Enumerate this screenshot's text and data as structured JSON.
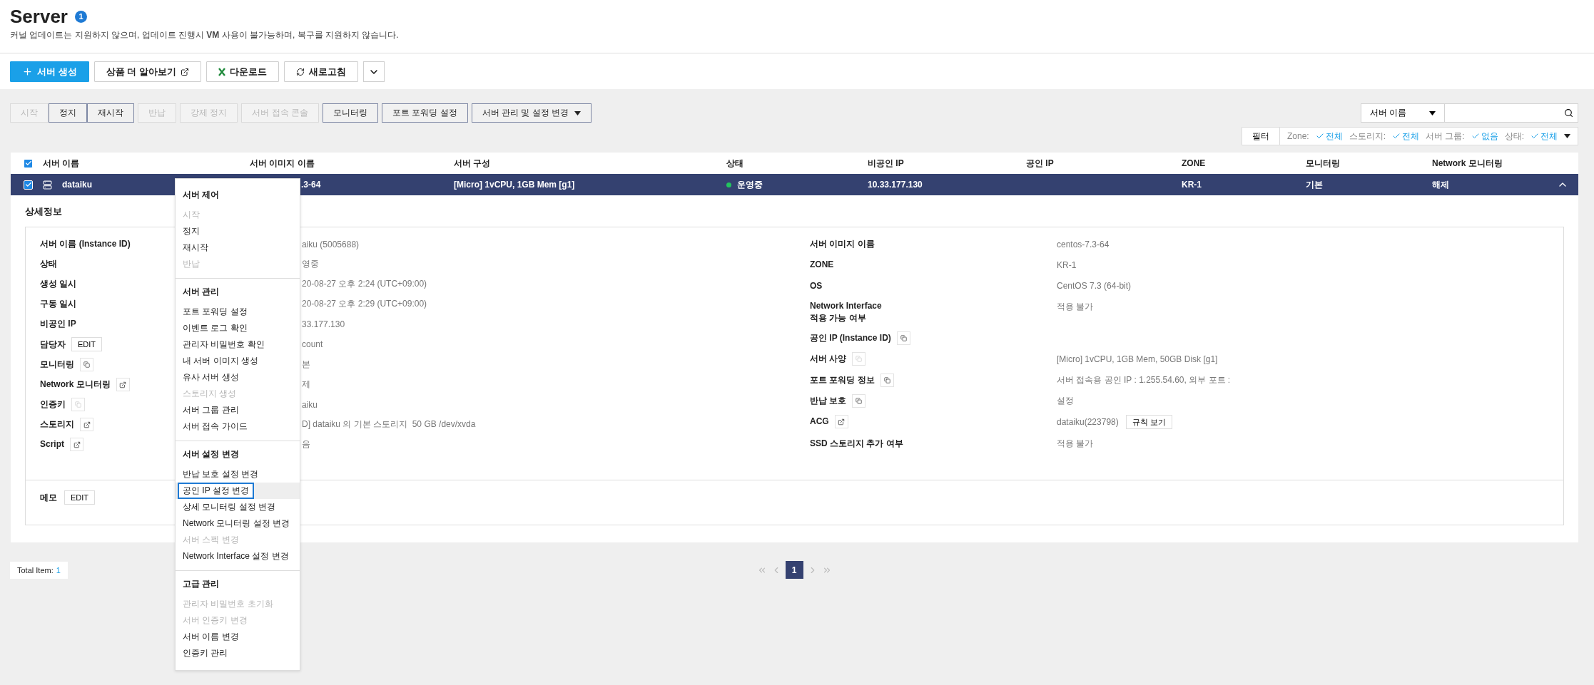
{
  "header": {
    "title": "Server",
    "badge": "1",
    "subtitle": "커널 업데이트는 지원하지 않으며, 업데이트 진행시 **VM** 사용이 불가능하며, 복구를 지원하지 않습니다."
  },
  "top_toolbar": [
    {
      "kind": "primary",
      "label": "서버 생성"
    },
    {
      "kind": "link",
      "label": "상품 더 알아보기"
    },
    {
      "kind": "excel",
      "label": "다운로드"
    },
    {
      "kind": "refresh",
      "label": "새로고침"
    },
    {
      "kind": "more"
    }
  ],
  "action_bar": [
    {
      "kind": "button",
      "label": "시작",
      "disabled": true
    },
    {
      "kind": "joined",
      "label": "정지",
      "disabled": false
    },
    {
      "kind": "joined",
      "label": "재시작",
      "disabled": false
    },
    {
      "kind": "button",
      "label": "반납",
      "disabled": true
    },
    {
      "kind": "button",
      "label": "강제 정지",
      "disabled": true
    },
    {
      "kind": "button",
      "label": "서버 접속 콘솔",
      "disabled": true
    },
    {
      "kind": "button",
      "label": "모니터링",
      "disabled": false
    },
    {
      "kind": "button",
      "label": "포트 포워딩 설정",
      "disabled": false
    },
    {
      "kind": "dropdown",
      "label": "서버 관리 및 설정 변경",
      "disabled": false
    }
  ],
  "search": {
    "field": "서버 이름"
  },
  "filter": {
    "button": "필터",
    "criteria": [
      {
        "name": "Zone:",
        "value": "전체"
      },
      {
        "name": "스토리지:",
        "value": "전체"
      },
      {
        "name": "서버 그룹:",
        "value": "없음"
      },
      {
        "name": "상태:",
        "value": "전체"
      }
    ]
  },
  "table": {
    "all_checked": true,
    "columns": [
      "서버 이름",
      "서버 이미지 이름",
      "서버 구성",
      "상태",
      "비공인 IP",
      "공인 IP",
      "ZONE",
      "모니터링",
      "Network 모니터링"
    ],
    "rows": [
      {
        "checked": true,
        "selected": true,
        "expanded": true,
        "name": "dataiku",
        "image": ".3-64",
        "spec": "[Micro] 1vCPU, 1GB Mem [g1]",
        "status": "운영중",
        "color": "#22c55e",
        "private_ip": "10.33.177.130",
        "zone": "KR-1",
        "monitoring": "기본",
        "network_monitoring": "해제"
      }
    ]
  },
  "detail": {
    "title": "상세정보",
    "left": [
      {
        "label": "서버 이름 (Instance ID)",
        "value": "aiku (5005688)"
      },
      {
        "label": "상태",
        "value": "영중"
      },
      {
        "label": "생성 일시",
        "value": "20-08-27 오후 2:24 (UTC+09:00)"
      },
      {
        "label": "구동 일시",
        "value": "20-08-27 오후 2:29 (UTC+09:00)"
      },
      {
        "label": "비공인 IP",
        "value": "33.177.130"
      },
      {
        "label": "담당자",
        "action": {
          "kind": "edit",
          "label": "EDIT"
        },
        "value": "count"
      },
      {
        "label": "모니터링",
        "action": {
          "kind": "copy",
          "disabled": false
        },
        "value": "본"
      },
      {
        "label": "Network 모니터링",
        "action": {
          "kind": "link",
          "disabled": false
        },
        "value": "제"
      },
      {
        "label": "인증키",
        "action": {
          "kind": "copy",
          "disabled": true
        },
        "value": "aiku"
      },
      {
        "label": "스토리지",
        "action": {
          "kind": "link",
          "disabled": false
        },
        "value": "D] dataiku 의 기본 스토리지  50 GB /dev/xvda"
      },
      {
        "label": "Script",
        "action": {
          "kind": "link",
          "disabled": false
        },
        "value": "음"
      }
    ],
    "right": [
      {
        "label": "서버 이미지 이름",
        "value": "centos-7.3-64"
      },
      {
        "label": "ZONE",
        "value": "KR-1"
      },
      {
        "label": "OS",
        "value": "CentOS 7.3 (64-bit)"
      },
      {
        "label": "Network Interface\n적용 가능 여부",
        "value": "적용 불가"
      },
      {
        "label": "공인 IP (Instance ID)",
        "action": {
          "kind": "copy",
          "disabled": false
        }
      },
      {
        "label": "서버 사양",
        "action": {
          "kind": "copy",
          "disabled": true
        },
        "value": "[Micro] 1vCPU, 1GB Mem, 50GB Disk [g1]"
      },
      {
        "label": "포트 포워딩 정보",
        "action": {
          "kind": "copy",
          "disabled": false
        },
        "value": "서버 접속용 공인 IP : 1.255.54.60, 외부 포트 :"
      },
      {
        "label": "반납 보호",
        "action": {
          "kind": "copy",
          "disabled": false
        },
        "value": "설정"
      },
      {
        "label": "ACG",
        "action": {
          "kind": "link",
          "disabled": false
        },
        "value": "dataiku(223798)",
        "value_button": "규칙 보기"
      },
      {
        "label": "SSD 스토리지 추가 여부",
        "value": "적용 불가"
      }
    ],
    "memo": {
      "label": "메모",
      "action": "EDIT"
    }
  },
  "context_menu": [
    {
      "title": "서버 제어",
      "items": [
        {
          "label": "시작",
          "disabled": true,
          "selected": false
        },
        {
          "label": "정지",
          "disabled": false,
          "selected": false
        },
        {
          "label": "재시작",
          "disabled": false,
          "selected": false
        },
        {
          "label": "반납",
          "disabled": true,
          "selected": false
        }
      ]
    },
    {
      "title": "서버 관리",
      "items": [
        {
          "label": "포트 포워딩 설정",
          "disabled": false,
          "selected": false
        },
        {
          "label": "이벤트 로그 확인",
          "disabled": false,
          "selected": false
        },
        {
          "label": "관리자 비밀번호 확인",
          "disabled": false,
          "selected": false
        },
        {
          "label": "내 서버 이미지 생성",
          "disabled": false,
          "selected": false
        },
        {
          "label": "유사 서버 생성",
          "disabled": false,
          "selected": false
        },
        {
          "label": "스토리지 생성",
          "disabled": true,
          "selected": false
        },
        {
          "label": "서버 그룹 관리",
          "disabled": false,
          "selected": false
        },
        {
          "label": "서버 접속 가이드",
          "disabled": false,
          "selected": false
        }
      ]
    },
    {
      "title": "서버 설정 변경",
      "items": [
        {
          "label": "반납 보호 설정 변경",
          "disabled": false,
          "selected": false
        },
        {
          "label": "공인 IP 설정 변경",
          "disabled": false,
          "selected": true
        },
        {
          "label": "상세 모니터링 설정 변경",
          "disabled": false,
          "selected": false
        },
        {
          "label": "Network 모니터링 설정 변경",
          "disabled": false,
          "selected": false
        },
        {
          "label": "서버 스펙 변경",
          "disabled": true,
          "selected": false
        },
        {
          "label": "Network Interface 설정 변경",
          "disabled": false,
          "selected": false
        }
      ]
    },
    {
      "title": "고급 관리",
      "items": [
        {
          "label": "관리자 비밀번호 초기화",
          "disabled": true,
          "selected": false
        },
        {
          "label": "서버 인증키 변경",
          "disabled": true,
          "selected": false
        },
        {
          "label": "서버 이름 변경",
          "disabled": false,
          "selected": false
        },
        {
          "label": "인증키 관리",
          "disabled": false,
          "selected": false
        }
      ]
    }
  ],
  "footer": {
    "total_label": "Total Item:",
    "total_count": "1",
    "pages": [
      {
        "label": "1",
        "selected": true
      }
    ]
  }
}
